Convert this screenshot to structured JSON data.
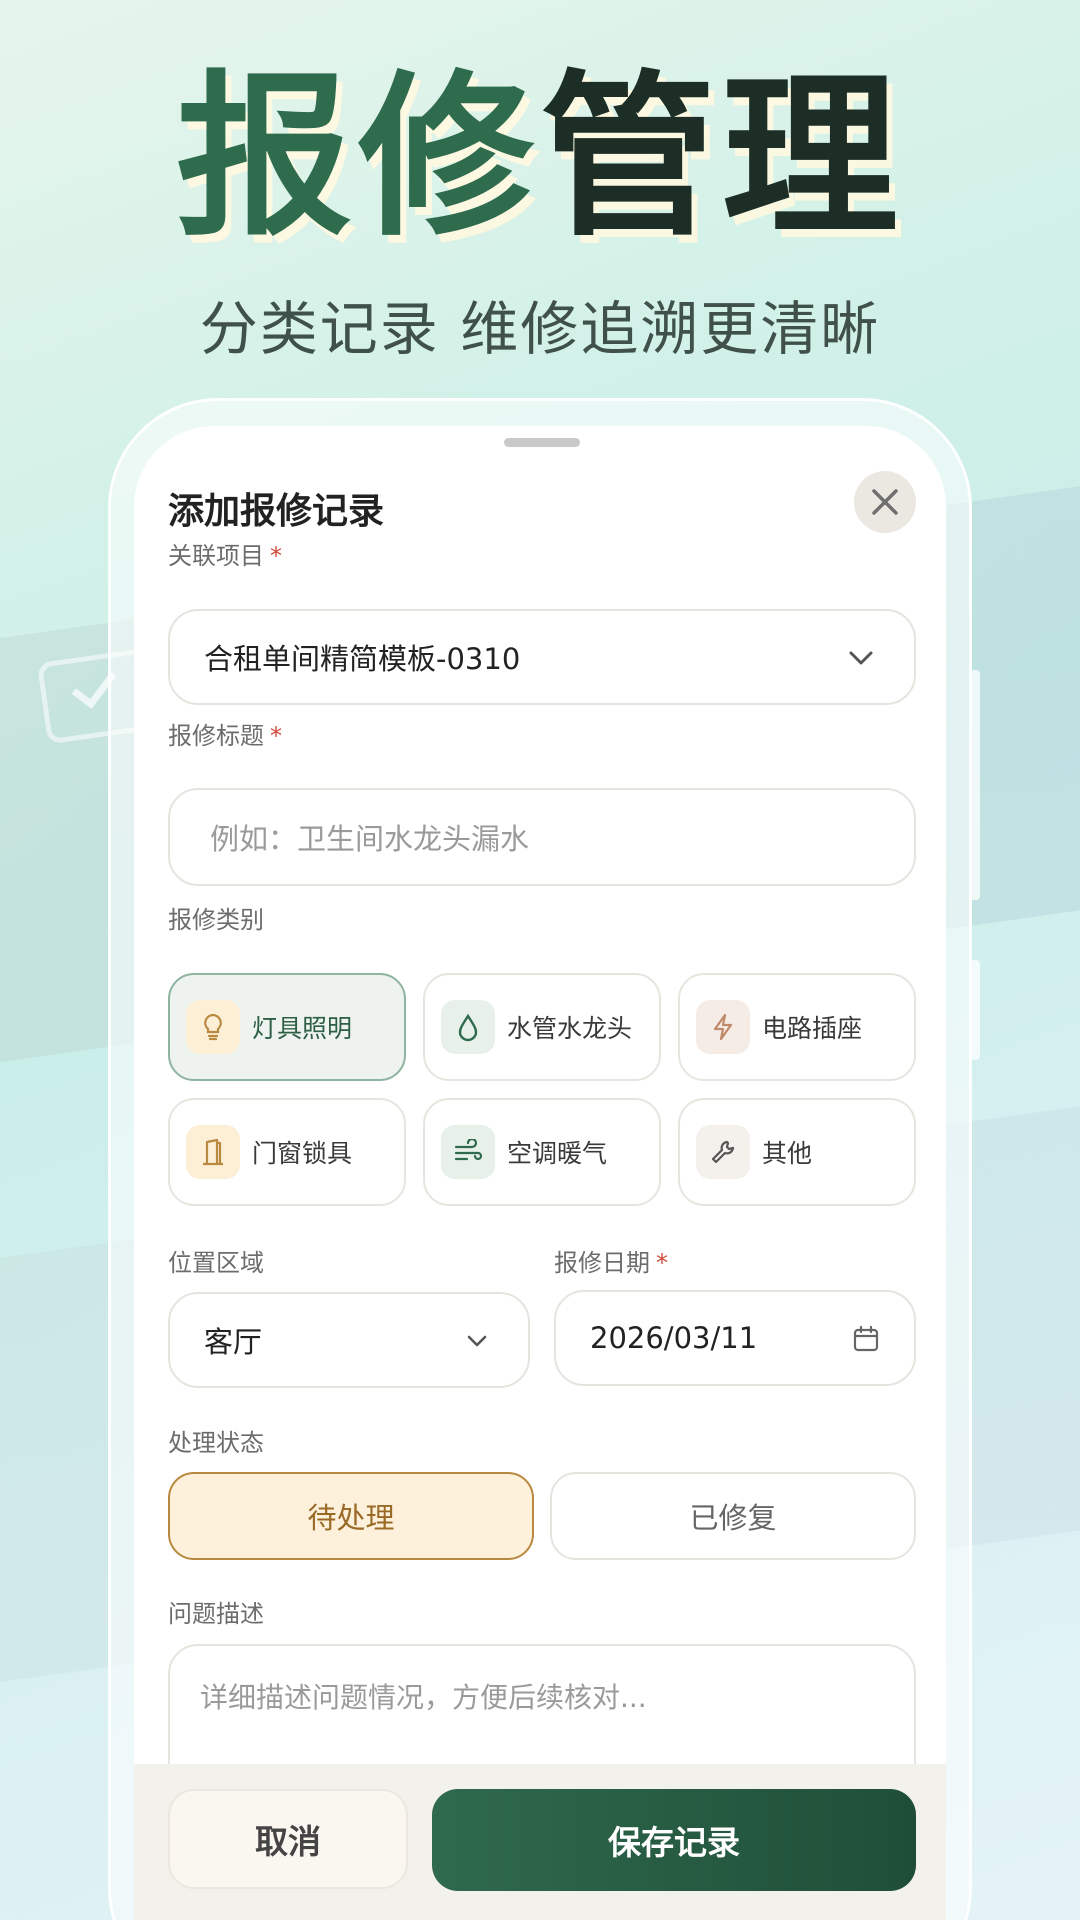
{
  "hero": {
    "title_part1": "报修",
    "title_part2": "管理",
    "subtitle": "分类记录 维修追溯更清晰"
  },
  "sheet": {
    "title": "添加报修记录",
    "close_icon": "close-icon"
  },
  "project": {
    "label": "关联项目",
    "required_mark": "*",
    "value": "合租单间精简模板-0310"
  },
  "repair_title": {
    "label": "报修标题",
    "required_mark": "*",
    "placeholder": "例如：卫生间水龙头漏水"
  },
  "category": {
    "label": "报修类别",
    "items": [
      {
        "label": "灯具照明",
        "icon": "lightbulb-icon",
        "selected": true
      },
      {
        "label": "水管水龙头",
        "icon": "water-drop-icon",
        "selected": false
      },
      {
        "label": "电路插座",
        "icon": "lightning-icon",
        "selected": false
      },
      {
        "label": "门窗锁具",
        "icon": "door-icon",
        "selected": false
      },
      {
        "label": "空调暖气",
        "icon": "wind-icon",
        "selected": false
      },
      {
        "label": "其他",
        "icon": "wrench-icon",
        "selected": false
      }
    ]
  },
  "location": {
    "label": "位置区域",
    "value": "客厅"
  },
  "date": {
    "label": "报修日期",
    "required_mark": "*",
    "value": "2026/03/11"
  },
  "status": {
    "label": "处理状态",
    "options": [
      "待处理",
      "已修复"
    ],
    "selected": "待处理"
  },
  "description": {
    "label": "问题描述",
    "placeholder": "详细描述问题情况，方便后续核对..."
  },
  "actions": {
    "cancel": "取消",
    "save": "保存记录"
  },
  "colors": {
    "brand_green": "#2f6a4d",
    "pending_amber": "#b8893f"
  }
}
